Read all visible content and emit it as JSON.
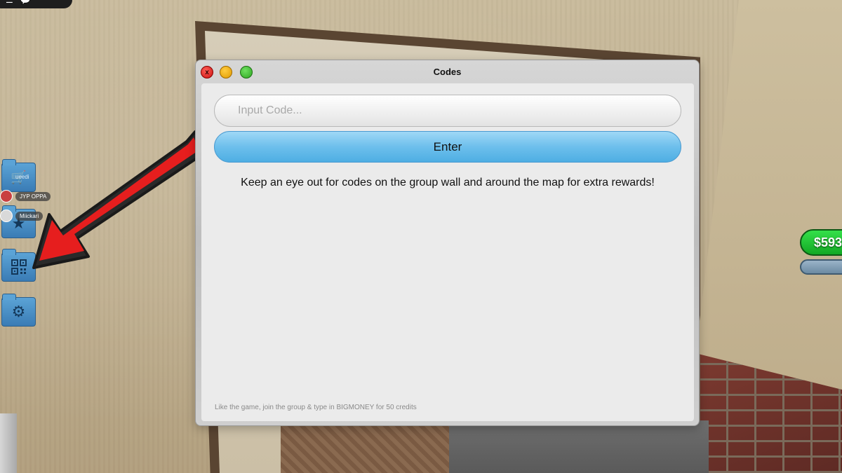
{
  "window": {
    "title": "Codes",
    "close_label": "x"
  },
  "codes": {
    "input_placeholder": "Input Code...",
    "enter_label": "Enter",
    "info": "Keep an eye out for codes on the group wall and around the map for extra rewards!",
    "footer": "Like the game, join the group & type in BIGMONEY for 50 credits"
  },
  "sidebar": {
    "shop_label": "ueedi",
    "players": [
      {
        "name": "JYP OPPA",
        "avatar_color": "#c94040"
      },
      {
        "name": "Miickari",
        "avatar_color": "#d9d9d9"
      }
    ],
    "buttons": [
      {
        "icon": "cart-icon"
      },
      {
        "icon": "star-icon"
      },
      {
        "icon": "qr-code-icon"
      },
      {
        "icon": "gear-icon"
      }
    ]
  },
  "hud": {
    "money": "$593"
  },
  "colors": {
    "enter_button": "#6dbfec",
    "money_badge": "#1fbf33",
    "arrow": "#e61e1e"
  }
}
